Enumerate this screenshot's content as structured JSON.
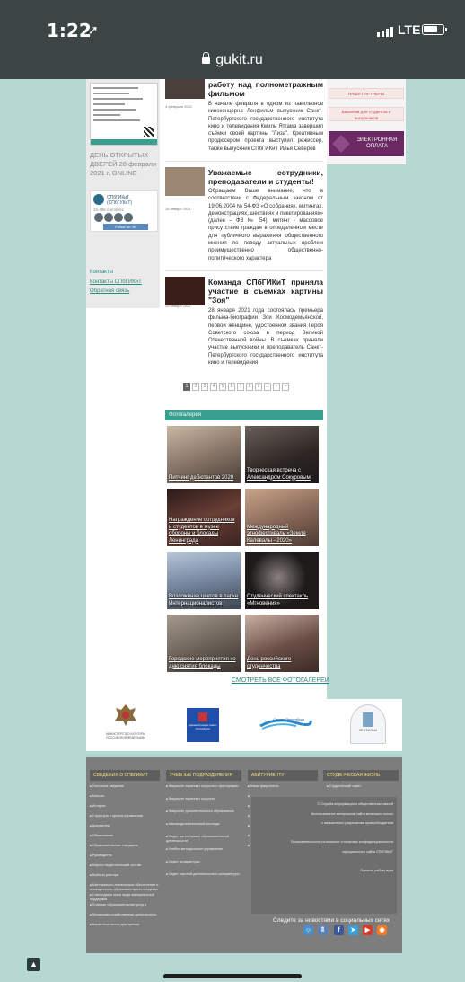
{
  "status": {
    "time": "1:22",
    "network": "LTE"
  },
  "browser": {
    "url": "gukit.ru"
  },
  "left": {
    "open_days": "ДЕНЬ ОТКРЫТЫХ ДВЕРЕЙ 28 февраля 2021 г. ONLINE",
    "vk": {
      "name": "СПбГИКиТ (СПбГУКиТ)",
      "members": "16,495 members",
      "follow": "Follow on VK"
    },
    "contacts_heading": "Контакты",
    "contacts_link": "Контакты СПбГИКиТ",
    "feedback_link": "Обратная связь"
  },
  "right": {
    "partners_btn": "НАШИ ПАРТНЕРЫ",
    "vacancies_btn": "Вакансии для студентов и выпускников",
    "pay_btn": "ЭЛЕКТРОННАЯ ОПЛАТА"
  },
  "news": [
    {
      "date": "4 февраля 2021",
      "title": "работу над полнометражным фильмом",
      "text": "В начале февраля в одном из павильонов киноконцерна Ленфильм выпускник Санкт-Петербургского государственного института кино и телевидения Кмиль Ятгама завершил съёмки своей картины \"Лиза\". Креативным продюсером проекта выступил режиссер, также выпускник СПбГИКиТ Илья Северов"
    },
    {
      "date": "28 января 2021",
      "title": "Уважаемые сотрудники, преподаватели и студенты!",
      "text": "Обращаем Ваше внимание, что в соответствии с Федеральным законом от 19.06.2004 № 54-ФЗ «О собраниях, митингах, демонстрациях, шествиях и пикетированиях» (далее – ФЗ № 54), митинг - массовое присутствие граждан в определенном месте для публичного выражения общественного мнения по поводу актуальных проблем преимущественно общественно-политического характера"
    },
    {
      "date": "28 января 2021",
      "title": "Команда СПбГИКиТ приняла участие в съемках картины \"Зоя\"",
      "text": "28 января 2021 года состоялась премьера фильма-биографии Зои Космодемьянской, первой женщине, удостоенной звания Героя Советского союза в период Великой Отечественной войны. В съемках приняли участие выпускники и преподаватель Санкт-Петербургского государственного института кино и телевидения"
    }
  ],
  "pagination": {
    "pages": [
      "1",
      "2",
      "3",
      "4",
      "5",
      "6",
      "7",
      "8",
      "9",
      "...",
      "›",
      "»"
    ],
    "active": "1"
  },
  "gallery": {
    "heading": "Фотогалерея",
    "photos": [
      {
        "caption": "Питчинг дебютантов 2020",
        "color": "#8a7566"
      },
      {
        "caption": "Творческая встреча с Александром Сокуровым",
        "color": "#3b3330"
      },
      {
        "caption": "Награждение сотрудников и студентов в музее обороны и блокады Ленинграда",
        "color": "#5a3f38"
      },
      {
        "caption": "Международный этнофестиваль «Земля Калевалы - 2020»",
        "color": "#8a6a5a"
      },
      {
        "caption": "Возложение цветов в парке Интернационалистов",
        "color": "#7c8ea6"
      },
      {
        "caption": "Студенческий спектакль «Мгновения»",
        "color": "#2a2626"
      },
      {
        "caption": "Городские мероприятия ко дню снятия блокады",
        "color": "#6b6058"
      },
      {
        "caption": "День российского студенчества",
        "color": "#6a4e46"
      }
    ],
    "see_all": "СМОТРЕТЬ ВСЕ ФОТОГАЛЕРЕИ"
  },
  "partners": [
    {
      "name": "МИНИСТЕРСТВО КУЛЬТУРЫ РОССИЙСКОЙ ФЕДЕРАЦИИ"
    },
    {
      "name": "Администрация Санкт-Петербурга"
    },
    {
      "name": "Санкт-Петербург"
    },
    {
      "name": "ЛЕНФИЛЬМ"
    }
  ],
  "footer": {
    "col1": {
      "heading": "СВЕДЕНИЯ О СПБГИКИТ",
      "items": [
        "Основные сведения",
        "Миссия",
        "История",
        "Структура и органы управления",
        "Документы",
        "Образование",
        "Образовательные стандарты",
        "Руководство",
        "Научно-педагогический состав",
        "Выборы ректора",
        "Материально-техническое обеспечение и оснащенность образовательного процесса",
        "Стипендии и иные виды материальной поддержки",
        "Платные образовательные услуги",
        "Финансово-хозяйственная деятельность",
        "Вакантные места для приема"
      ]
    },
    "col2": {
      "heading": "УЧЕБНЫЕ ПОДРАЗДЕЛЕНИЯ",
      "items": [
        "Факультет экранных искусств и фотографии",
        "Факультет экранных искусств",
        "Факультет дополнительного образования",
        "Киновидеотехнический колледж",
        "Отдел магистерских образовательной деятельности",
        "Учебно-методическое управление",
        "Отдел аспирантуры",
        "Отдел научной деятельности и аспирантуры"
      ]
    },
    "col3": {
      "heading": "АБИТУРИЕНТУ",
      "items": [
        "Наши факультеты",
        "",
        "",
        "",
        "",
        "",
        ""
      ]
    },
    "col4": {
      "heading": "СТУДЕНЧЕСКАЯ ЖИЗНЬ",
      "items": [
        "Студенческий совет"
      ]
    },
    "box_lines": [
      "© Служба информации и общественных связей",
      "Использование материалов сайта возможно только",
      "с письменного разрешения правообладателя",
      "Пользовательское соглашение и политика конфиденциальности",
      "официального сайта СПбГИКиТ",
      "Оценить работу вуза"
    ],
    "social_heading": "Следите за новостями в социальных сетях",
    "social_icons": [
      "ok-icon",
      "vk-icon",
      "facebook-icon",
      "telegram-icon",
      "youtube-icon",
      "rss-icon"
    ]
  }
}
